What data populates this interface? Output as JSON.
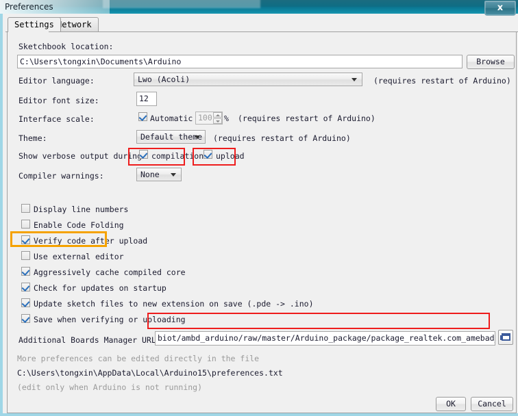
{
  "window": {
    "title": "Preferences",
    "close_label": "x"
  },
  "tabs": [
    {
      "label": "Settings",
      "active": true
    },
    {
      "label": "Network",
      "active": false
    }
  ],
  "settings": {
    "sketchbook": {
      "label": "Sketchbook location:",
      "value": "C:\\Users\\tongxin\\Documents\\Arduino",
      "browse_label": "Browse"
    },
    "editor_language": {
      "label": "Editor language:",
      "value": "Lwo (Acoli)",
      "note": "(requires restart of Arduino)"
    },
    "editor_font_size": {
      "label": "Editor font size:",
      "value": "12"
    },
    "interface_scale": {
      "label": "Interface scale:",
      "automatic_label": "Automatic",
      "automatic_checked": true,
      "scale_value": "100",
      "percent_label": "%",
      "note": "(requires restart of Arduino)"
    },
    "theme": {
      "label": "Theme:",
      "value": "Default theme",
      "note": "(requires restart of Arduino)"
    },
    "verbose": {
      "label": "Show verbose output during:",
      "compilation_label": "compilation",
      "compilation_checked": true,
      "upload_label": "upload",
      "upload_checked": true
    },
    "compiler_warnings": {
      "label": "Compiler warnings:",
      "value": "None"
    },
    "checkboxes": [
      {
        "label": "Display line numbers",
        "checked": false
      },
      {
        "label": "Enable Code Folding",
        "checked": false
      },
      {
        "label": "Verify code after upload",
        "checked": true
      },
      {
        "label": "Use external editor",
        "checked": false
      },
      {
        "label": "Aggressively cache compiled core",
        "checked": true
      },
      {
        "label": "Check for updates on startup",
        "checked": true
      },
      {
        "label": "Update sketch files to new extension on save (.pde -> .ino)",
        "checked": true
      },
      {
        "label": "Save when verifying or uploading",
        "checked": true
      }
    ],
    "boards_manager": {
      "label": "Additional Boards Manager URLs:",
      "value": "biot/ambd_arduino/raw/master/Arduino_package/package_realtek.com_amebad_index.json",
      "expand_icon": "window-expand-icon"
    },
    "footer": {
      "line1": "More preferences can be edited directly in the file",
      "line2": "C:\\Users\\tongxin\\AppData\\Local\\Arduino15\\preferences.txt",
      "line3": "(edit only when Arduino is not running)"
    }
  },
  "buttons": {
    "ok_label": "OK",
    "cancel_label": "Cancel"
  },
  "annotations": {
    "highlight_red": "#ee1c1c",
    "highlight_orange": "#f5a200"
  }
}
